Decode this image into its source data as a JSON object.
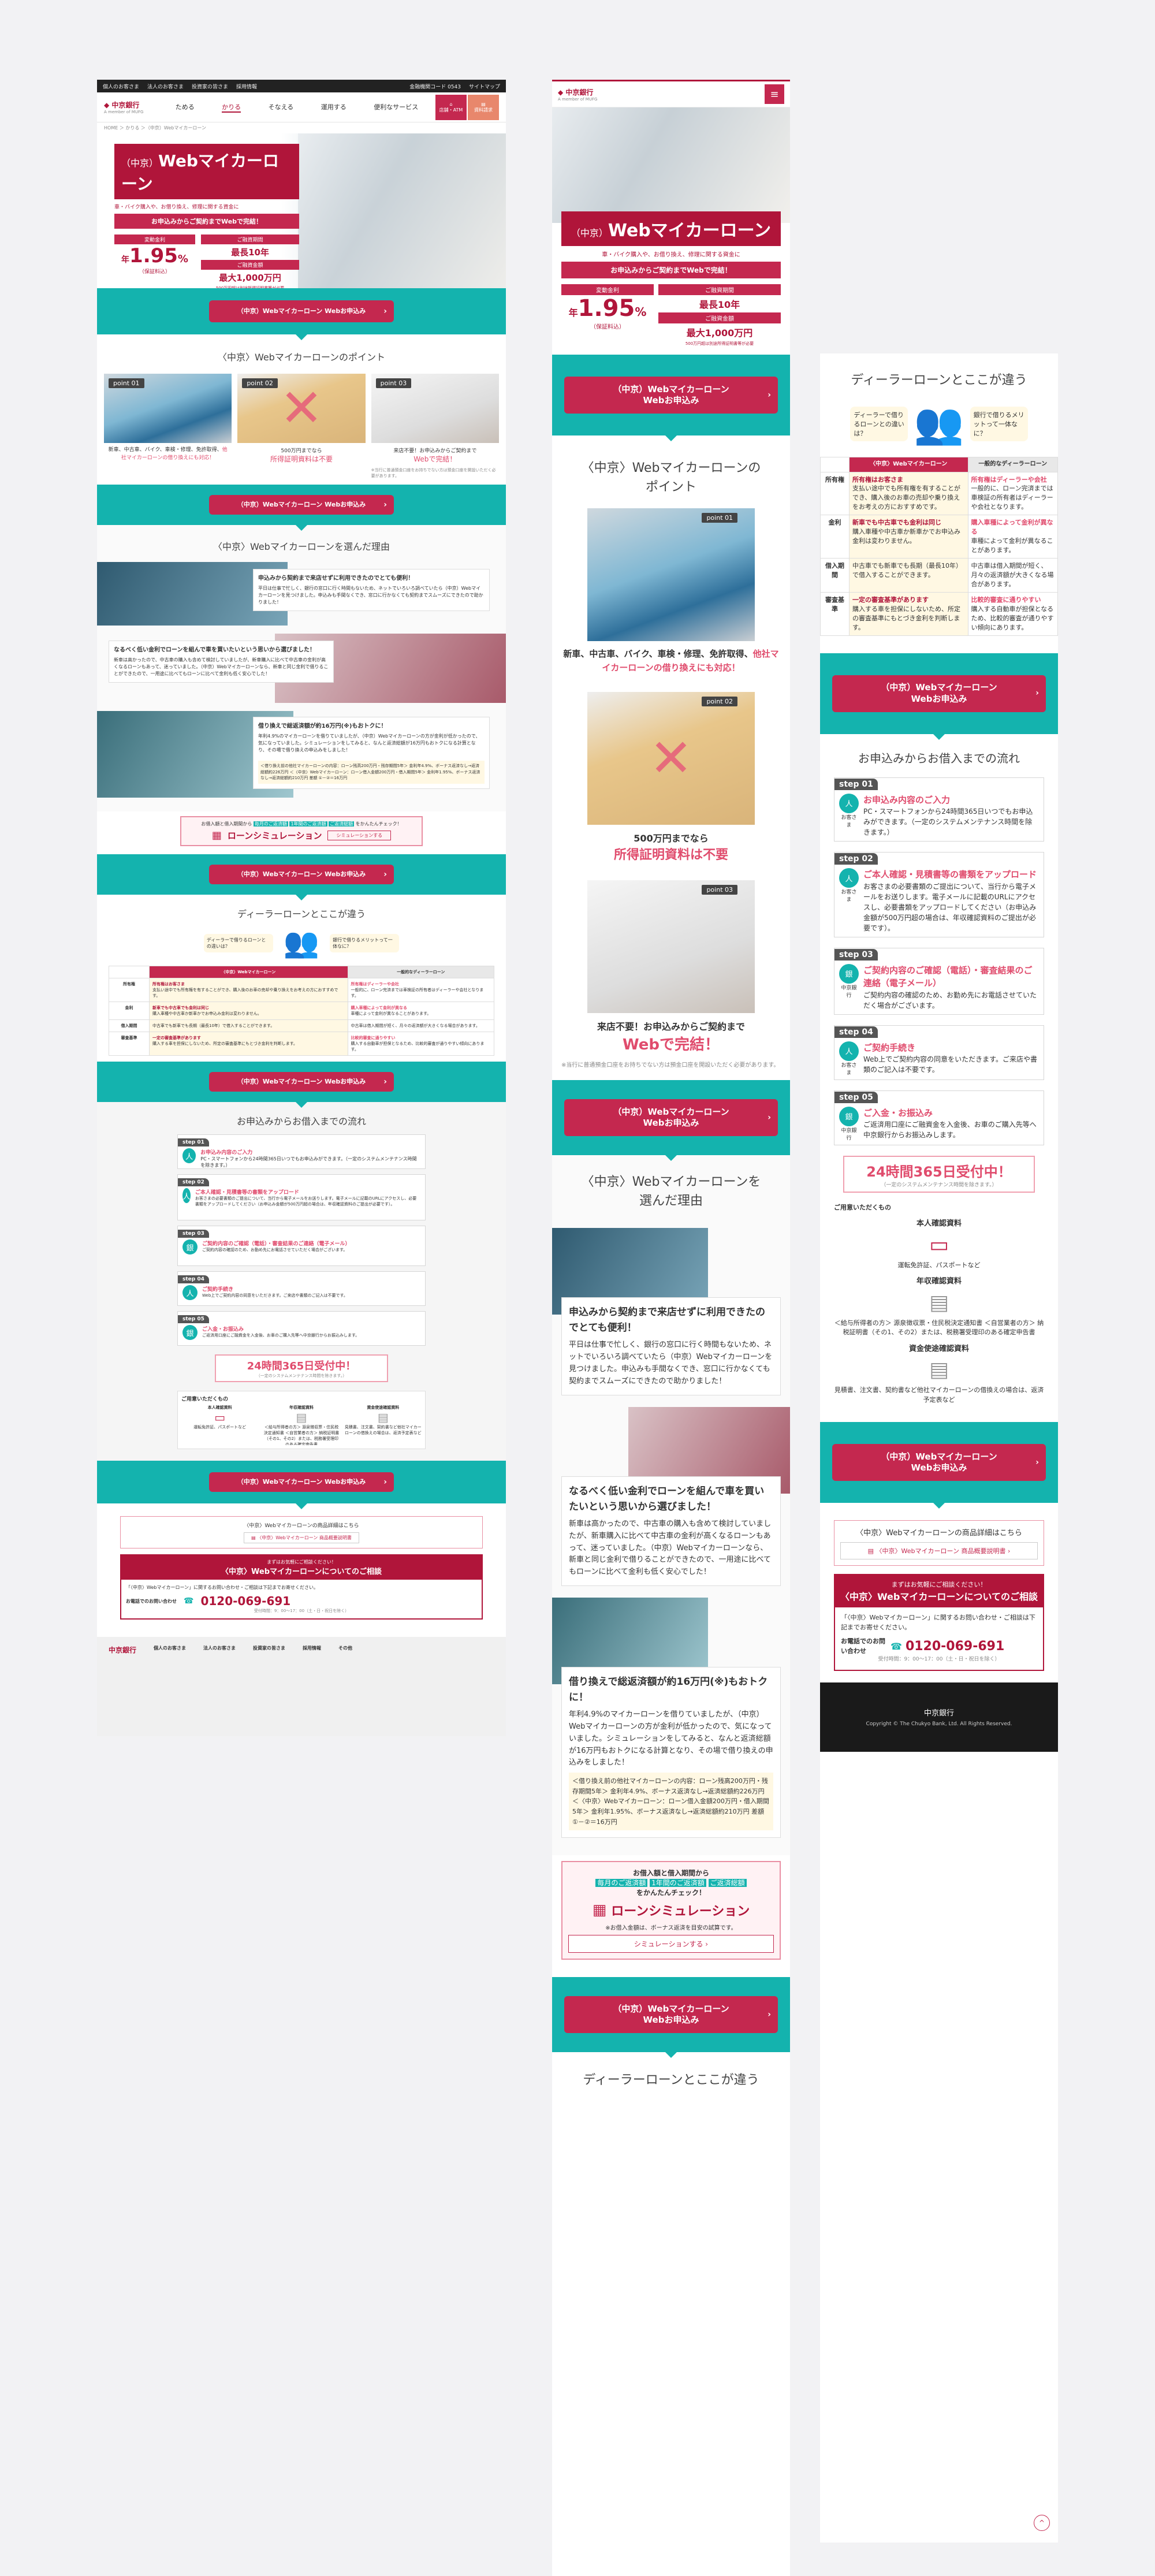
{
  "header": {
    "util_links": [
      "個人のお客さま",
      "法人のお客さま",
      "投資家の皆さま",
      "採用情報"
    ],
    "util_right": [
      "金融機関コード 0543",
      "サイトマップ"
    ],
    "logo_text": "中京銀行",
    "logo_sub": "A member of MUFG",
    "nav": [
      "ためる",
      "かりる",
      "そなえる",
      "運用する",
      "便利なサービス"
    ],
    "nav_btn1": "店舗・ATM",
    "nav_btn2": "資料請求"
  },
  "breadcrumb": "HOME ＞ かりる ＞（中京）Webマイカーローン",
  "hero": {
    "label": "（中京）",
    "title": "Webマイカーローン",
    "sub": "車・バイク購入や、お借り換え、修理に関する資金に",
    "lead": "お申込みからご契約までWebで完結！",
    "rate_label": "変動金利",
    "rate_prefix": "年",
    "rate": "1.95",
    "rate_unit": "%",
    "rate_note": "（保証料込）",
    "term_label": "ご融資期間",
    "term": "最長10年",
    "amount_label": "ご融資金額",
    "amount": "最大1,000万円",
    "amount_note": "500万円超は別途所得証明書等が必要"
  },
  "cta_label": "（中京）Webマイカーローン Webお申込み",
  "cta_line1": "（中京）Webマイカーローン",
  "cta_line2": "Webお申込み",
  "points": {
    "title": "〈中京〉Webマイカーローンのポイント",
    "title_line1": "〈中京〉Webマイカーローンの",
    "title_line2": "ポイント",
    "items": [
      {
        "badge": "point 01",
        "text": "新車、中古車、バイク、車検・修理、免許取得、",
        "hl": "他社マイカーローンの借り換えにも対応！"
      },
      {
        "badge": "point 02",
        "text": "500万円までなら",
        "hl": "所得証明資料は不要"
      },
      {
        "badge": "point 03",
        "text": "来店不要！お申込みからご契約まで",
        "hl": "Webで完結！"
      }
    ],
    "note": "※当行に普通預金口座をお持ちでない方は預金口座を開設いただく必要があります。"
  },
  "reasons": {
    "title": "〈中京〉Webマイカーローンを選んだ理由",
    "title_line1": "〈中京〉Webマイカーローンを",
    "title_line2": "選んだ理由",
    "items": [
      {
        "head": "申込みから契約まで来店せずに利用できたのでとても便利！",
        "body": "平日は仕事で忙しく、銀行の窓口に行く時間もないため、ネットでいろいろ調べていたら（中京）Webマイカーローンを見つけました。申込みも手間なくでき、窓口に行かなくても契約までスムーズにできたので助かりました！"
      },
      {
        "head": "なるべく低い金利でローンを組んで車を買いたいという思いから選びました！",
        "body": "新車は高かったので、中古車の購入も含めて検討していましたが、新車購入に比べて中古車の金利が高くなるローンもあって、迷っていました。（中京）Webマイカーローンなら、新車と同じ金利で借りることができたので、一用途に比べてもローンに比べて金利も低く安心でした！"
      },
      {
        "head": "借り換えで総返済額が約16万円(※)もおトクに！",
        "body": "年利4.9%のマイカーローンを借りていましたが、（中京）Webマイカーローンの方が金利が低かったので、気になっていました。シミュレーションをしてみると、なんと返済総額が16万円もおトクになる計算となり、その場で借り換えの申込みをしました！"
      }
    ],
    "calc": "＜借り換え前の他社マイカーローンの内容：ローン残高200万円・残存期間5年＞ 金利年4.9%、ボーナス返済なし→返済総額約226万円 ＜〈中京〉Webマイカーローン：ローン借入金額200万円・借入期間5年＞ 金利年1.95%、ボーナス返済なし→返済総額約210万円 差額 ①－②＝16万円"
  },
  "simulation": {
    "head": "お借入額と借入期間から",
    "tags": [
      "毎月のご返済額",
      "1年間のご返済額",
      "ご返済総額"
    ],
    "tail": "をかんたんチェック！",
    "title": "ローンシミュレーション",
    "note": "※お借入金額は、ボーナス返済を目安の試算です。",
    "btn": "シミュレーションする"
  },
  "compare": {
    "title": "ディーラーローンとここが違う",
    "bubble1": "ディーラーで借りるローンとの違いは？",
    "bubble2": "銀行で借りるメリットって一体なに？",
    "col1": "〈中京〉Webマイカーローン",
    "col2": "一般的なディーラーローン",
    "rows": [
      {
        "h": "所有権",
        "a_hl": "所有権はお客さま",
        "a": "支払い途中でも所有権を有することができ、購入後のお車の売却や乗り換えをお考えの方におすすめです。",
        "b_hl": "所有権はディーラーや会社",
        "b": "一般的に、ローン完済までは車検証の所有者はディーラーや会社となります。"
      },
      {
        "h": "金利",
        "a_hl": "新車でも中古車でも金利は同じ",
        "a": "購入車種や中古車か新車かでお申込み金利は変わりません。",
        "b_hl": "購入車種によって金利が異なる",
        "b": "車種によって金利が異なることがあります。"
      },
      {
        "h": "借入期間",
        "a_hl": "",
        "a": "中古車でも新車でも長期（最長10年）で借入することができます。",
        "b_hl": "",
        "b": "中古車は借入期間が短く、月々の返済額が大きくなる場合があります。"
      },
      {
        "h": "審査基準",
        "a_hl": "一定の審査基準があります",
        "a": "購入する車を担保にしないため、所定の審査基準にもとづき金利を判断します。",
        "b_hl": "比較的審査に通りやすい",
        "b": "購入する自動車が担保となるため、比較的審査が通りやすい傾向にあります。"
      }
    ]
  },
  "flow": {
    "title": "お申込みからお借入までの流れ",
    "steps": [
      {
        "tag": "step 01",
        "who": "お客さま",
        "title": "お申込み内容のご入力",
        "body": "PC・スマートフォンから24時間365日いつでもお申込みができます。（一定のシステムメンテナンス時間を除きます。）"
      },
      {
        "tag": "step 02",
        "who": "お客さま",
        "title": "ご本人確認・見積書等の書類をアップロード",
        "body": "お客さまの必要書類のご提出について、当行から電子メールをお送りします。電子メールに記載のURLにアクセスし、必要書類をアップロードしてください（お申込み金額が500万円超の場合は、年収確認資料のご提出が必要です）。"
      },
      {
        "tag": "step 03",
        "who": "中京銀行",
        "title": "ご契約内容のご確認（電話）・審査結果のご連絡（電子メール）",
        "body": "ご契約内容の確認のため、お勤め先にお電話させていただく場合がございます。"
      },
      {
        "tag": "step 04",
        "who": "お客さま",
        "title": "ご契約手続き",
        "body": "Web上でご契約内容の同意をいただきます。ご来店や書類のご記入は不要です。"
      },
      {
        "tag": "step 05",
        "who": "中京銀行",
        "title": "ご入金・お振込み",
        "body": "ご返済用口座にご融資金を入金後、お車のご購入先等へ中京銀行からお振込みします。"
      }
    ],
    "hours": "24時間365日受付中！",
    "hours_note": "（一定のシステムメンテナンス時間を除きます。）"
  },
  "docs": {
    "title": "ご用意いただくもの",
    "items": [
      {
        "h": "本人確認資料",
        "b": "運転免許証、パスポートなど"
      },
      {
        "h": "年収確認資料",
        "b": "＜給与所得者の方＞ 源泉徴収票・住民税決定通知書 ＜自営業者の方＞ 納税証明書（その1、その2）または、税務署受理印のある確定申告書"
      },
      {
        "h": "資金使途確認資料",
        "b": "見積書、注文書、契約書など他社マイカーローンの借換えの場合は、返済予定表など"
      }
    ]
  },
  "product": {
    "text": "〈中京〉Webマイカーローンの商品詳細はこちら",
    "btn": "〈中京〉Webマイカーローン 商品概要説明書"
  },
  "consult": {
    "head": "まずはお気軽にご相談ください！",
    "title": "〈中京〉Webマイカーローンについてのご相談",
    "desc": "「〈中京〉Webマイカーローン」に関するお問い合わせ・ご相談は下記までお寄せください。",
    "tel_label": "お電話でのお問い合わせ",
    "tel": "0120-069-691",
    "hours": "受付時間：9：00〜17：00（土・日・祝日を除く）"
  },
  "footer": {
    "cols": [
      "個人のお客さま",
      "法人のお客さま",
      "投資家の皆さま",
      "採用情報",
      "その他"
    ],
    "copyright": "Copyright © The Chukyo Bank, Ltd. All Rights Reserved."
  }
}
